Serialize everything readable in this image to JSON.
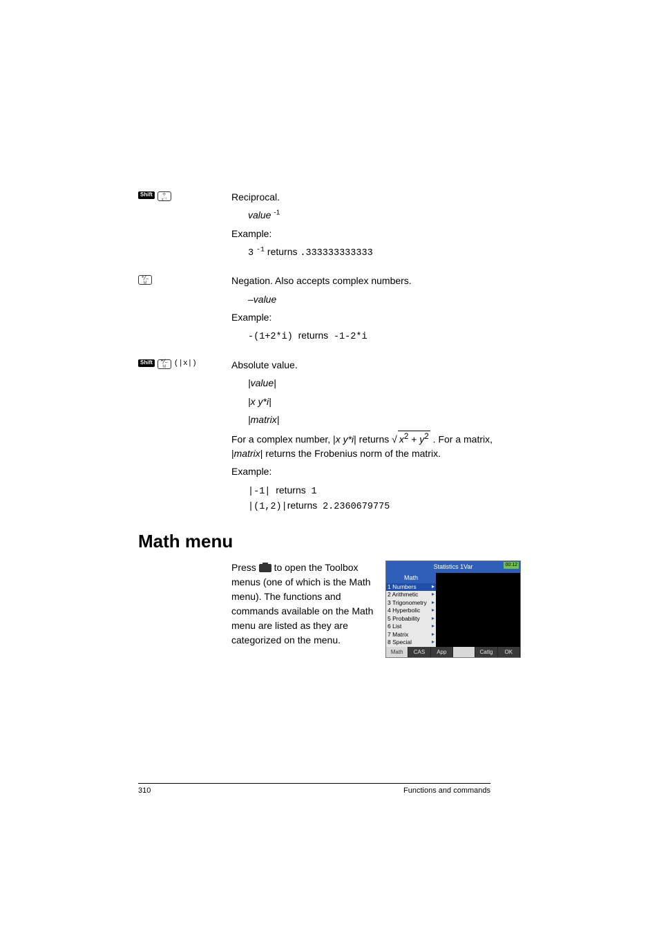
{
  "sections": [
    {
      "keys": {
        "shift": "Shift",
        "main_top": "÷",
        "main_sub": "x⁻¹"
      },
      "title": "Reciprocal.",
      "syntax_lines": [
        "value ⁻¹"
      ],
      "example_label": "Example:",
      "example_expr": "3 ⁻¹",
      "example_returns_word": "returns",
      "example_result": ".333333333333"
    },
    {
      "keys": {
        "shift": null,
        "main_top": "⁺⁄₋",
        "main_sub": "M"
      },
      "title": "Negation. Also accepts complex numbers.",
      "syntax_lines": [
        "–value"
      ],
      "example_label": "Example:",
      "example_expr": "-(1+2*i)",
      "example_returns_word": "returns",
      "example_result": "-1-2*i"
    },
    {
      "keys": {
        "shift": "Shift",
        "main_top": "⁺⁄₋",
        "main_sub": "M",
        "suffix": "(|x|)"
      },
      "title": "Absolute value.",
      "syntax_lines": [
        "|value|",
        "|x  y*i|",
        "|matrix|"
      ],
      "complex_pre": "For a complex number, |",
      "complex_arg": "x  y*i",
      "complex_mid": "| returns ",
      "complex_sqrt": "x² + y²",
      "complex_post": " . For a matrix, |",
      "complex_matrix": "matrix",
      "complex_end": "| returns the Frobenius norm of the matrix.",
      "example_label": "Example:",
      "examples": [
        {
          "expr": "|-1|",
          "word": "returns",
          "result": "1"
        },
        {
          "expr": "|(1,2)|",
          "word": "returns",
          "result": "2.2360679775"
        }
      ]
    }
  ],
  "heading": "Math menu",
  "math_menu_text": "Press  to open the Toolbox menus (one of which is the Math menu). The functions and commands available on the Math menu are listed as they are categorized on the menu.",
  "calc": {
    "title": "Statistics 1Var",
    "time": "00:12",
    "menu_header": "Math",
    "items": [
      {
        "n": "1",
        "label": "Numbers",
        "sel": true
      },
      {
        "n": "2",
        "label": "Arithmetic",
        "sel": false
      },
      {
        "n": "3",
        "label": "Trigonometry",
        "sel": false
      },
      {
        "n": "4",
        "label": "Hyperbolic",
        "sel": false
      },
      {
        "n": "5",
        "label": "Probability",
        "sel": false
      },
      {
        "n": "6",
        "label": "List",
        "sel": false
      },
      {
        "n": "7",
        "label": "Matrix",
        "sel": false
      },
      {
        "n": "8",
        "label": "Special",
        "sel": false
      }
    ],
    "tabs": [
      "Math",
      "CAS",
      "App",
      "",
      "Catlg",
      "OK"
    ]
  },
  "footer": {
    "page": "310",
    "chapter": "Functions and commands"
  }
}
